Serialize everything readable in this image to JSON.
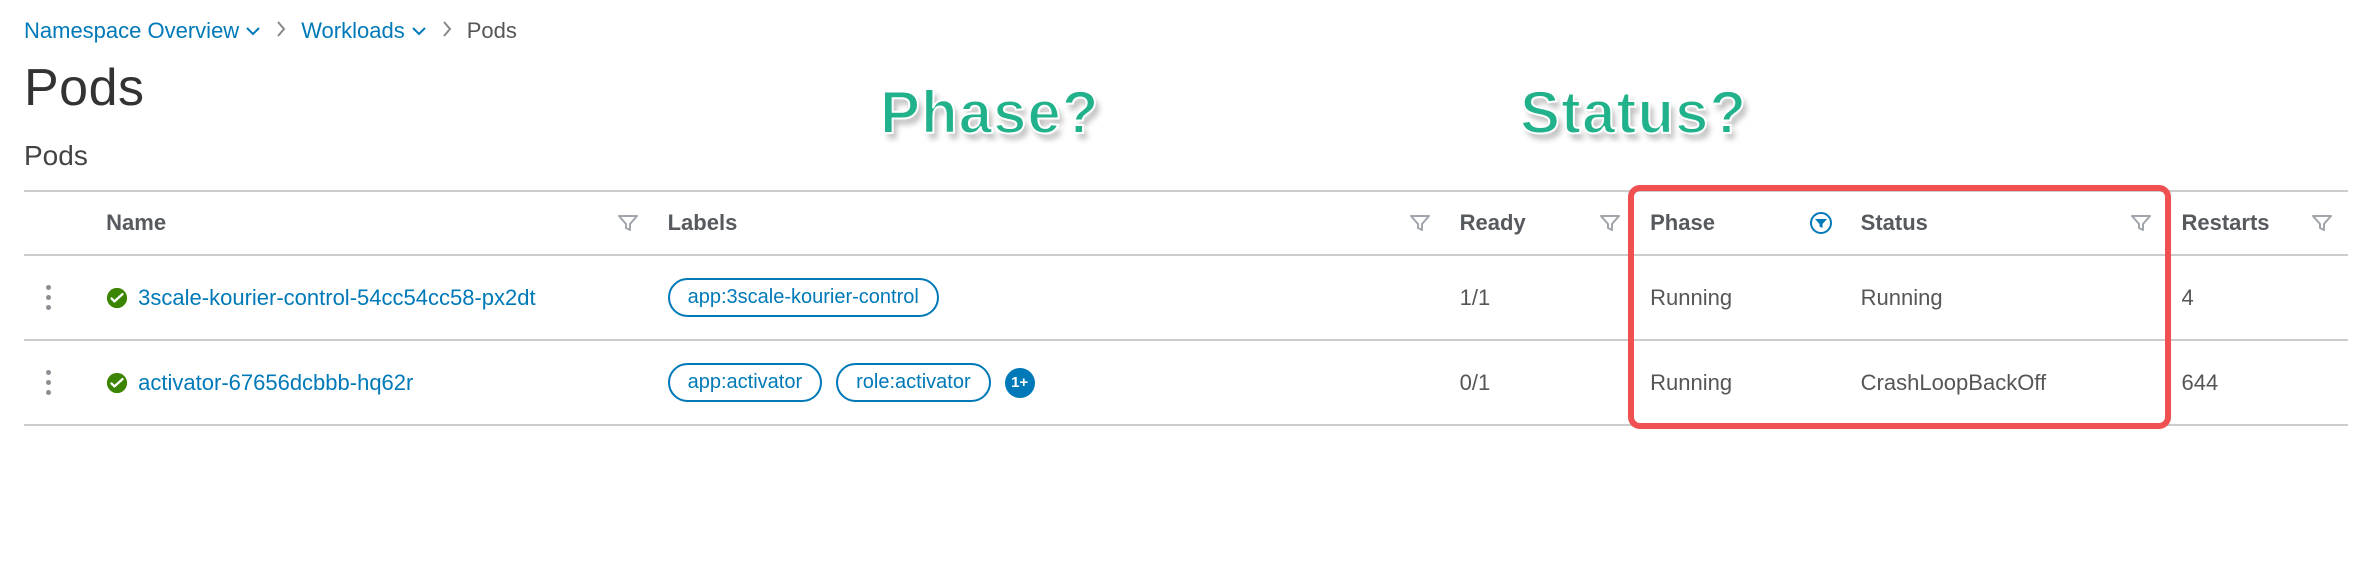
{
  "breadcrumb": {
    "items": [
      {
        "label": "Namespace Overview",
        "dropdown": true,
        "link": true
      },
      {
        "label": "Workloads",
        "dropdown": true,
        "link": true
      },
      {
        "label": "Pods",
        "dropdown": false,
        "link": false
      }
    ]
  },
  "page_title": "Pods",
  "section_title": "Pods",
  "columns": {
    "name": "Name",
    "labels": "Labels",
    "ready": "Ready",
    "phase": "Phase",
    "status": "Status",
    "restarts": "Restarts"
  },
  "rows": [
    {
      "name": "3scale-kourier-control-54cc54cc58-px2dt",
      "labels": [
        "app:3scale-kourier-control"
      ],
      "more_labels": null,
      "ready": "1/1",
      "phase": "Running",
      "status": "Running",
      "restarts": "4"
    },
    {
      "name": "activator-67656dcbbb-hq62r",
      "labels": [
        "app:activator",
        "role:activator"
      ],
      "more_labels": "1+",
      "ready": "0/1",
      "phase": "Running",
      "status": "CrashLoopBackOff",
      "restarts": "644"
    }
  ],
  "annotations": {
    "phase": "Phase?",
    "status": "Status?"
  }
}
